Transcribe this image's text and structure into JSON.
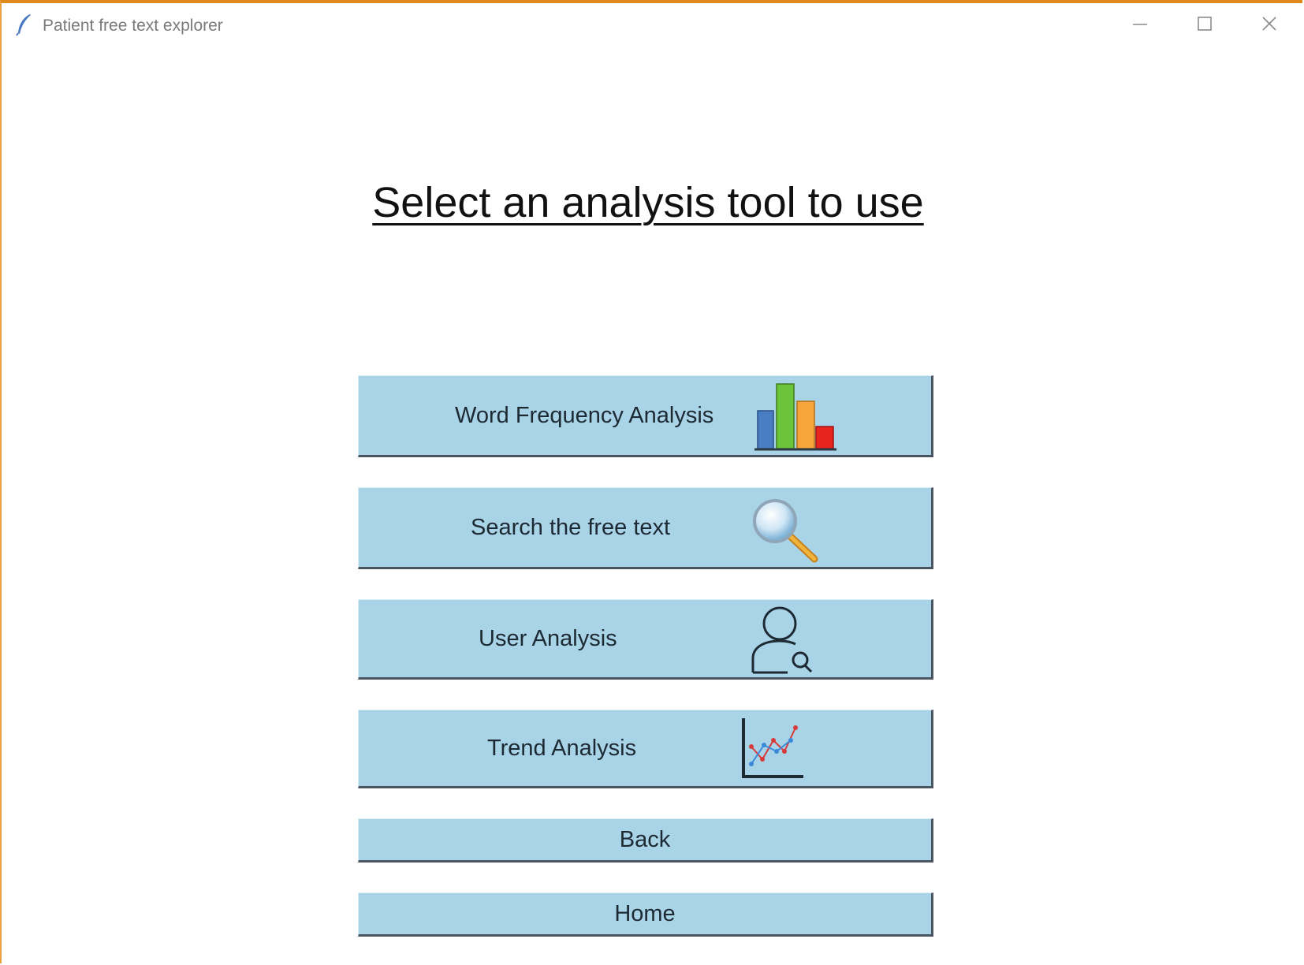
{
  "window": {
    "title": "Patient free text explorer",
    "icon": "feather-icon",
    "controls": [
      "minimize-icon",
      "maximize-icon",
      "close-icon"
    ]
  },
  "main": {
    "heading": "Select an analysis tool to use",
    "tools": [
      {
        "label": "Word Frequency Analysis",
        "icon": "bar-chart-icon"
      },
      {
        "label": "Search the free text",
        "icon": "magnifier-icon"
      },
      {
        "label": "User Analysis",
        "icon": "user-search-icon"
      },
      {
        "label": "Trend Analysis",
        "icon": "line-chart-icon"
      }
    ],
    "back_label": "Back",
    "home_label": "Home"
  },
  "colors": {
    "button_bg": "#a9d3e6",
    "window_border": "#e08a1e"
  }
}
